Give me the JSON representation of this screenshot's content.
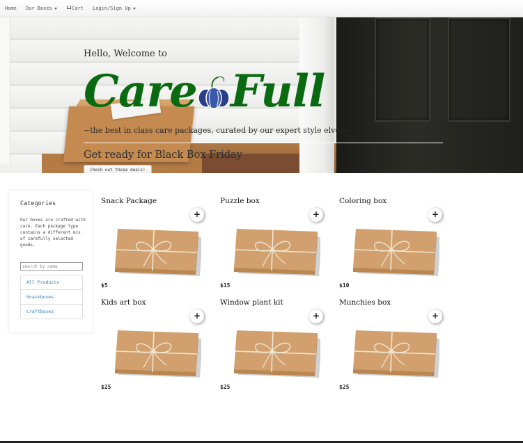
{
  "nav": {
    "home": "Home",
    "boxes": "Our Boxes",
    "cart": "Cart",
    "login": "Login/Sign Up"
  },
  "hero": {
    "greeting": "Hello, Welcome to",
    "brand_part1": "Care",
    "brand_part2": "Full",
    "tagline": "~the best in class care packages, curated by our expert style elves~",
    "promo": "Get ready for Black Box Friday",
    "cta_label": "Check out these deals!"
  },
  "sidebar": {
    "title": "Categories",
    "description": "Our boxes are crafted with care. Each package type contains a different mix of carefully selected goods.",
    "search_placeholder": "search by name",
    "items": [
      {
        "label": "All Products"
      },
      {
        "label": "Snackboxes"
      },
      {
        "label": "Craftboxes"
      }
    ]
  },
  "products": [
    {
      "name": "Snack Package",
      "price": "$5",
      "add": "+"
    },
    {
      "name": "Puzzle box",
      "price": "$15",
      "add": "+"
    },
    {
      "name": "Coloring box",
      "price": "$10",
      "add": "+"
    },
    {
      "name": "Kids art box",
      "price": "$25",
      "add": "+"
    },
    {
      "name": "Window plant kit",
      "price": "$25",
      "add": "+"
    },
    {
      "name": "Munchies box",
      "price": "$25",
      "add": "+"
    }
  ],
  "colors": {
    "brand_green": "#0a6a12",
    "link_blue": "#337ab7",
    "kraft_paper": "#d1a06e"
  },
  "icons": {
    "cart": "cart-icon",
    "add": "plus-icon",
    "logo_mark": "pumpkin-icon"
  }
}
